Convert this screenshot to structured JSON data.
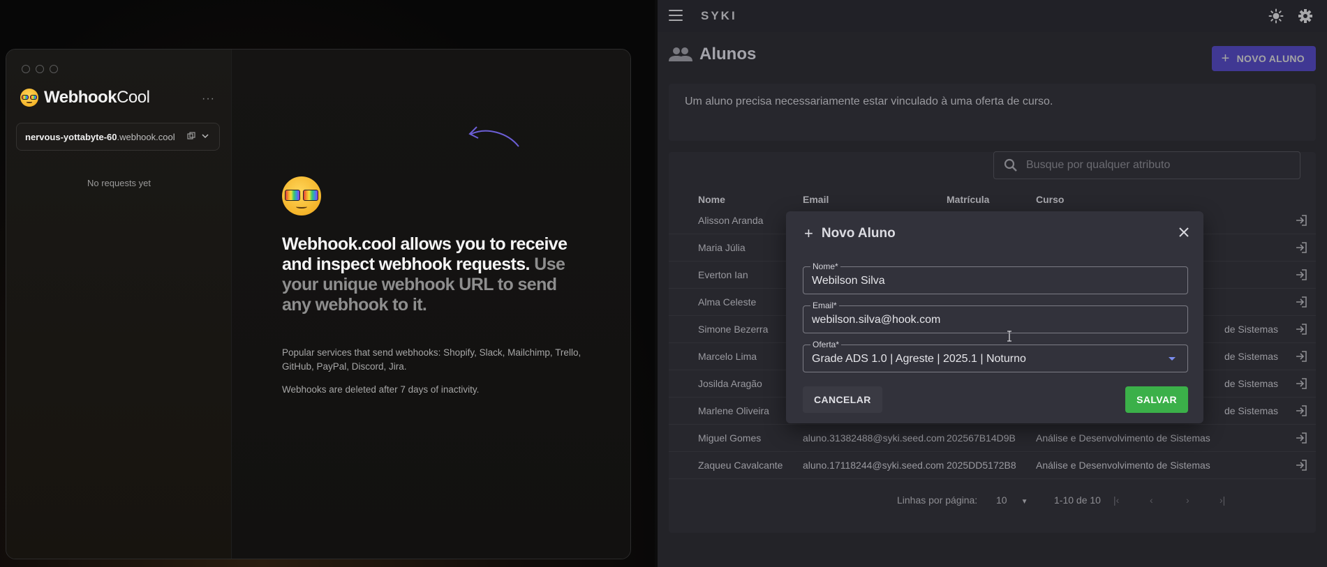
{
  "webhook": {
    "window_dots": [
      "",
      "",
      ""
    ],
    "brand_bold": "Webhook",
    "brand_light": "Cool",
    "more_label": "···",
    "url_subdomain": "nervous-yottabyte-60",
    "url_domain": ".webhook.cool",
    "empty_state": "No requests yet",
    "headline_bold": "Webhook.cool allows you to receive and inspect webhook requests.",
    "headline_muted": " Use your unique webhook URL to send any webhook to it.",
    "popular_services": "Popular services that send webhooks: Shopify, Slack, Mailchimp, Trello, GitHub, PayPal, Discord, Jira.",
    "deletion_note": "Webhooks are deleted after 7 days of inactivity."
  },
  "syki": {
    "app_title": "SYKI",
    "page_title": "Alunos",
    "new_button_label": "NOVO ALUNO",
    "info_text": "Um aluno precisa necessariamente estar vinculado à uma oferta de curso.",
    "search_placeholder": "Busque por qualquer atributo",
    "columns": [
      "Nome",
      "Email",
      "Matrícula",
      "Curso"
    ],
    "rows": [
      {
        "nome": "Alisson Aranda",
        "email": "",
        "matricula": "",
        "curso": ""
      },
      {
        "nome": "Maria Júlia",
        "email": "",
        "matricula": "",
        "curso": ""
      },
      {
        "nome": "Everton Ian",
        "email": "",
        "matricula": "",
        "curso": ""
      },
      {
        "nome": "Alma Celeste",
        "email": "",
        "matricula": "",
        "curso": ""
      },
      {
        "nome": "Simone Bezerra",
        "email": "",
        "matricula": "",
        "curso": "de Sistemas"
      },
      {
        "nome": "Marcelo Lima",
        "email": "",
        "matricula": "",
        "curso": "de Sistemas"
      },
      {
        "nome": "Josilda Aragão",
        "email": "",
        "matricula": "",
        "curso": "de Sistemas"
      },
      {
        "nome": "Marlene Oliveira",
        "email": "",
        "matricula": "",
        "curso": "de Sistemas"
      },
      {
        "nome": "Miguel Gomes",
        "email": "aluno.31382488@syki.seed.com",
        "matricula": "202567B14D9B",
        "curso": "Análise e Desenvolvimento de Sistemas"
      },
      {
        "nome": "Zaqueu Cavalcante",
        "email": "aluno.17118244@syki.seed.com",
        "matricula": "2025DD5172B8",
        "curso": "Análise e Desenvolvimento de Sistemas"
      }
    ],
    "pagination": {
      "rows_per_page_label": "Linhas por página:",
      "rows_per_page": "10",
      "range": "1-10 de 10"
    },
    "dialog": {
      "title": "Novo Aluno",
      "name_label": "Nome*",
      "name_value": "Webilson Silva",
      "email_label": "Email*",
      "email_value": "webilson.silva@hook.com",
      "offer_label": "Oferta*",
      "offer_value": "Grade ADS 1.0 | Agreste | 2025.1 | Noturno",
      "cancel_label": "CANCELAR",
      "save_label": "SALVAR"
    },
    "colors": {
      "primary": "#594ae2",
      "success": "#3bb049",
      "surface": "#2b2b33",
      "background": "#26262d"
    }
  }
}
